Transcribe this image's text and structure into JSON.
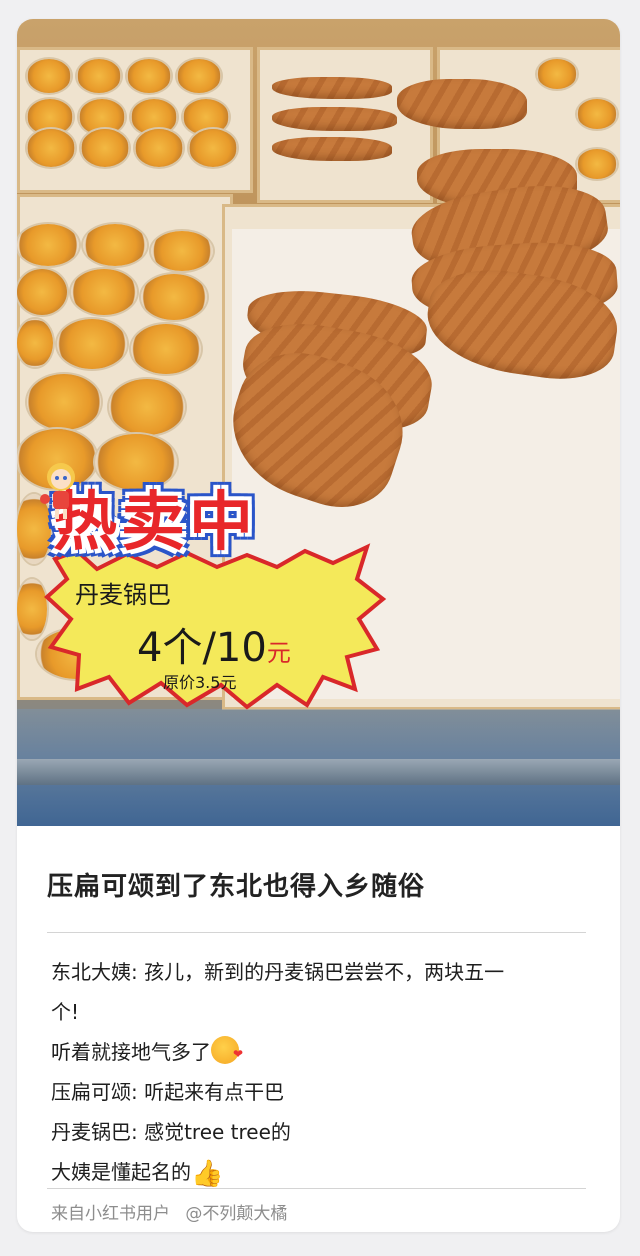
{
  "photo": {
    "sign": {
      "headline": "热卖中",
      "product_name": "丹麦锅巴",
      "price_main": "4个/10",
      "price_unit": "元",
      "original_price": "原价3.5元"
    }
  },
  "post": {
    "title": "压扁可颂到了东北也得入乡随俗",
    "lines": [
      "东北大姨: 孩儿，新到的丹麦锅巴尝尝不，两块五一",
      "个!",
      "听着就接地气多了",
      "压扁可颂: 听起来有点干巴",
      "丹麦锅巴: 感觉tree tree的",
      "大姨是懂起名的"
    ],
    "emoji_kiss": "kiss-face-icon",
    "emoji_thumb": "thumbs-up-icon"
  },
  "footer": {
    "source": "来自小红书用户",
    "handle": "@不列颠大橘"
  }
}
